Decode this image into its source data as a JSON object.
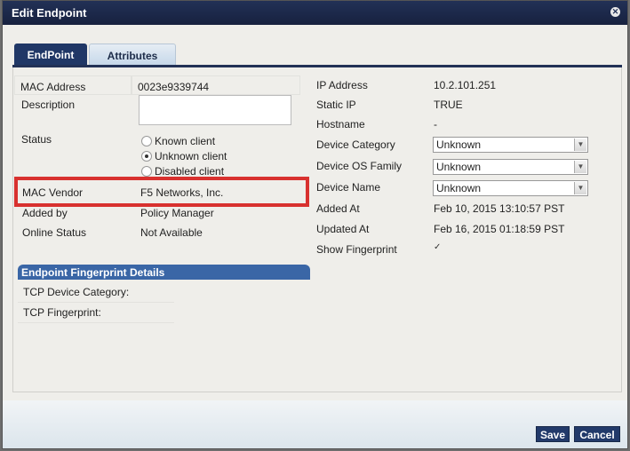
{
  "dialog": {
    "title": "Edit Endpoint",
    "close_icon": "close-circle-icon"
  },
  "tabs": [
    {
      "label": "EndPoint",
      "active": true
    },
    {
      "label": "Attributes",
      "active": false
    }
  ],
  "left": {
    "mac_address": {
      "label": "MAC Address",
      "value": "0023e9339744"
    },
    "description": {
      "label": "Description",
      "value": ""
    },
    "status": {
      "label": "Status",
      "options": [
        "Known client",
        "Unknown client",
        "Disabled client"
      ],
      "selected": "Unknown client"
    },
    "mac_vendor": {
      "label": "MAC Vendor",
      "value": "F5 Networks, Inc."
    },
    "added_by": {
      "label": "Added by",
      "value": "Policy Manager"
    },
    "online_status": {
      "label": "Online Status",
      "value": "Not Available"
    }
  },
  "right": {
    "ip_address": {
      "label": "IP Address",
      "value": "10.2.101.251"
    },
    "static_ip": {
      "label": "Static IP",
      "value": "TRUE"
    },
    "hostname": {
      "label": "Hostname",
      "value": "-"
    },
    "device_category": {
      "label": "Device Category",
      "value": "Unknown"
    },
    "device_os_family": {
      "label": "Device OS Family",
      "value": "Unknown"
    },
    "device_name": {
      "label": "Device Name",
      "value": "Unknown"
    },
    "added_at": {
      "label": "Added At",
      "value": "Feb 10, 2015 13:10:57 PST"
    },
    "updated_at": {
      "label": "Updated At",
      "value": "Feb 16, 2015 01:18:59 PST"
    },
    "show_fingerprint": {
      "label": "Show Fingerprint",
      "checked": true,
      "mark": "✓"
    }
  },
  "fingerprint": {
    "title": "Endpoint Fingerprint Details",
    "tcp_device_category": "TCP Device Category:",
    "tcp_fingerprint": "TCP Fingerprint:"
  },
  "footer": {
    "save": "Save",
    "cancel": "Cancel"
  },
  "colors": {
    "titlebar": "#1b2748",
    "tab_active": "#203766",
    "highlight": "#d8312f",
    "section_header": "#3a66a6"
  }
}
